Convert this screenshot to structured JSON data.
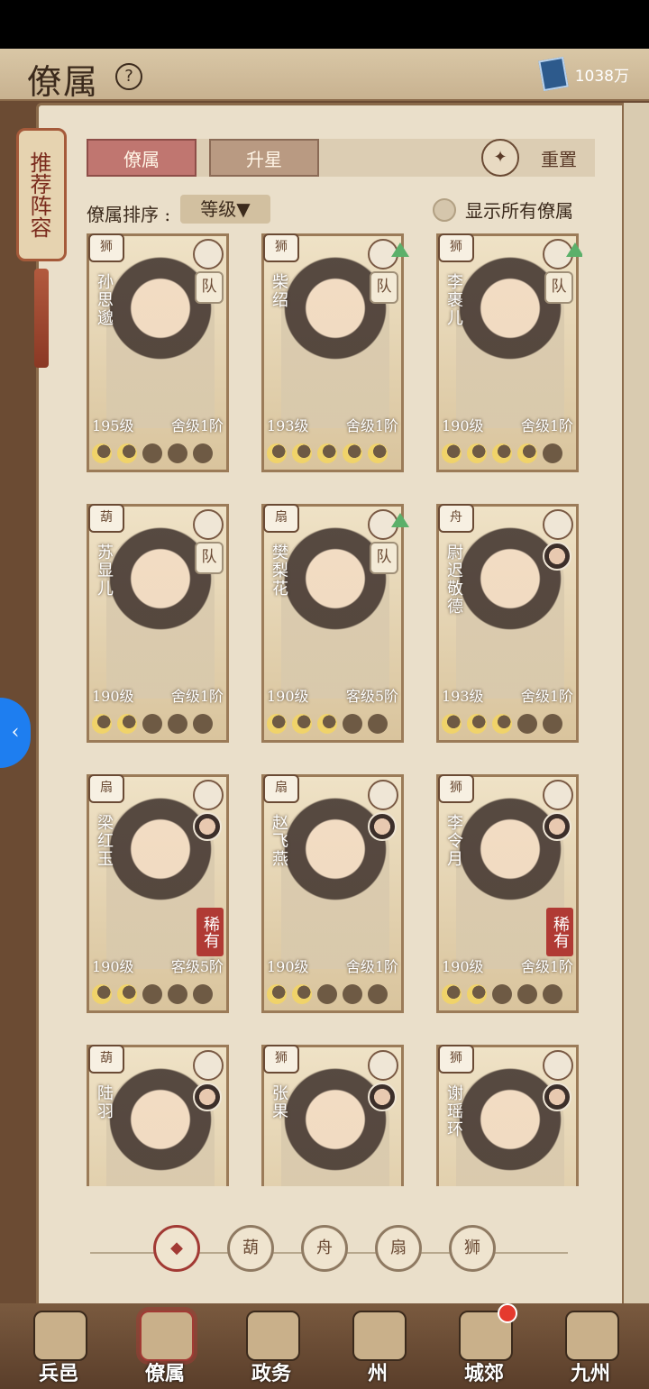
{
  "header": {
    "title": "僚属",
    "help_icon": "question-icon",
    "currency": "1038万",
    "currency_icon": "book-icon"
  },
  "recommend": {
    "label": "推荐阵容"
  },
  "tabs": [
    {
      "label": "僚属",
      "active": true
    },
    {
      "label": "升星",
      "active": false
    }
  ],
  "reset": {
    "label": "重置",
    "icon": "reset-icon"
  },
  "sort": {
    "label": "僚属排序 :",
    "value": "等级▼"
  },
  "show_all": {
    "label": "显示所有僚属",
    "checked": false
  },
  "cards": [
    {
      "name": "孙思邈",
      "level": "195级",
      "house": "舍级1阶",
      "moons_on": 2,
      "team": "队",
      "sect": "lion",
      "skill": "cloud"
    },
    {
      "name": "柴绍",
      "level": "193级",
      "house": "舍级1阶",
      "moons_on": 5,
      "team": "队",
      "sect": "lion",
      "skill": "sword",
      "upgrade": true
    },
    {
      "name": "李裹儿",
      "level": "190级",
      "house": "舍级1阶",
      "moons_on": 4,
      "team": "队",
      "sect": "lion",
      "skill": "yinyang",
      "upgrade": true
    },
    {
      "name": "苏显儿",
      "level": "190级",
      "house": "舍级1阶",
      "moons_on": 2,
      "team": "队",
      "sect": "gourd",
      "skill": "sword"
    },
    {
      "name": "樊梨花",
      "level": "190级",
      "house": "客级5阶",
      "moons_on": 3,
      "team": "队",
      "sect": "fan",
      "skill": "book",
      "upgrade": true
    },
    {
      "name": "尉迟敬德",
      "level": "193级",
      "house": "舍级1阶",
      "moons_on": 3,
      "sect": "ship",
      "skill": "sword",
      "buddy": true
    },
    {
      "name": "梁红玉",
      "level": "190级",
      "house": "客级5阶",
      "moons_on": 2,
      "rare": "稀有",
      "sect": "fan",
      "skill": "book",
      "buddy": true
    },
    {
      "name": "赵飞燕",
      "level": "190级",
      "house": "舍级1阶",
      "moons_on": 2,
      "sect": "fan",
      "skill": "sword",
      "buddy": true
    },
    {
      "name": "李令月",
      "level": "190级",
      "house": "舍级1阶",
      "moons_on": 2,
      "rare": "稀有",
      "sect": "lion",
      "skill": "yinyang",
      "buddy": true
    },
    {
      "name": "陆羽",
      "level": "",
      "house": "",
      "moons_on": 0,
      "sect": "gourd",
      "skill": "cloud",
      "buddy": true
    },
    {
      "name": "张果",
      "level": "",
      "house": "",
      "moons_on": 0,
      "sect": "lion",
      "skill": "yinyang",
      "buddy": true
    },
    {
      "name": "谢瑶环",
      "level": "",
      "house": "",
      "moons_on": 0,
      "sect": "lion",
      "skill": "sword",
      "buddy": true
    }
  ],
  "filters": [
    {
      "icon": "diamond-icon",
      "active": true
    },
    {
      "icon": "gourd-icon",
      "active": false
    },
    {
      "icon": "ship-icon",
      "active": false
    },
    {
      "icon": "fan-icon",
      "active": false
    },
    {
      "icon": "lion-icon",
      "active": false
    }
  ],
  "nav": [
    {
      "label": "兵邑",
      "active": false
    },
    {
      "label": "僚属",
      "active": true
    },
    {
      "label": "政务",
      "active": false
    },
    {
      "label": "州",
      "active": false
    },
    {
      "label": "城郊",
      "active": false,
      "badge": true
    },
    {
      "label": "九州",
      "active": false
    }
  ],
  "colors": {
    "accent": "#a23a34",
    "paper": "#eadfca",
    "wood": "#6b4b33",
    "moon_on": "#f0d36a",
    "sidebtn": "#1e7ef0"
  }
}
